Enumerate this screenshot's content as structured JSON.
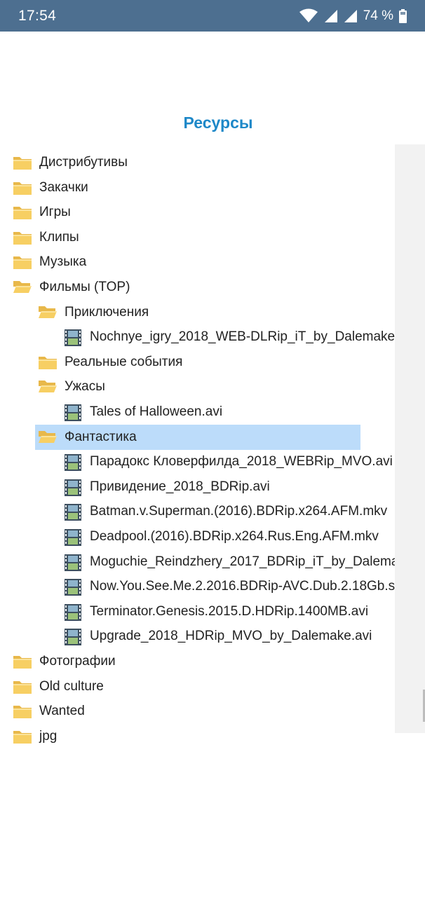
{
  "status_bar": {
    "time": "17:54",
    "battery": "74 %",
    "icons": [
      "wifi-icon",
      "signal-icon",
      "signal-icon",
      "battery-icon"
    ]
  },
  "title": "Ресурсы",
  "tree": [
    {
      "label": "Дистрибутивы",
      "type": "folder",
      "level": 0,
      "open": false
    },
    {
      "label": "Закачки",
      "type": "folder",
      "level": 0,
      "open": false
    },
    {
      "label": "Игры",
      "type": "folder",
      "level": 0,
      "open": false
    },
    {
      "label": "Клипы",
      "type": "folder",
      "level": 0,
      "open": false
    },
    {
      "label": "Музыка",
      "type": "folder",
      "level": 0,
      "open": false
    },
    {
      "label": "Фильмы (TOP)",
      "type": "folder",
      "level": 0,
      "open": true
    },
    {
      "label": "Приключения",
      "type": "folder",
      "level": 1,
      "open": true
    },
    {
      "label": "Nochnye_igry_2018_WEB-DLRip_iT_by_Dalemake.",
      "type": "video",
      "level": 2
    },
    {
      "label": "Реальные события",
      "type": "folder",
      "level": 1,
      "open": false
    },
    {
      "label": "Ужасы",
      "type": "folder",
      "level": 1,
      "open": true
    },
    {
      "label": "Tales of Halloween.avi",
      "type": "video",
      "level": 2
    },
    {
      "label": "Фантастика",
      "type": "folder",
      "level": 1,
      "open": true,
      "selected": true
    },
    {
      "label": "Парадокс Кловерфилда_2018_WEBRip_MVO.avi",
      "type": "video",
      "level": 2
    },
    {
      "label": "Привидение_2018_BDRip.avi",
      "type": "video",
      "level": 2
    },
    {
      "label": "Batman.v.Superman.(2016).BDRip.x264.AFM.mkv",
      "type": "video",
      "level": 2
    },
    {
      "label": "Deadpool.(2016).BDRip.x264.Rus.Eng.AFM.mkv",
      "type": "video",
      "level": 2
    },
    {
      "label": "Moguchie_Reindzhery_2017_BDRip_iT_by_Dalema",
      "type": "video",
      "level": 2
    },
    {
      "label": "Now.You.See.Me.2.2016.BDRip-AVC.Dub.2.18Gb.s",
      "type": "video",
      "level": 2
    },
    {
      "label": "Terminator.Genesis.2015.D.HDRip.1400MB.avi",
      "type": "video",
      "level": 2
    },
    {
      "label": "Upgrade_2018_HDRip_MVO_by_Dalemake.avi",
      "type": "video",
      "level": 2
    },
    {
      "label": "Фотографии",
      "type": "folder",
      "level": 0,
      "open": false
    },
    {
      "label": "Old culture",
      "type": "folder",
      "level": 0,
      "open": false
    },
    {
      "label": "Wanted",
      "type": "folder",
      "level": 0,
      "open": false
    },
    {
      "label": "jpg",
      "type": "folder",
      "level": 0,
      "open": false
    }
  ],
  "colors": {
    "status_bar": "#4d6f90",
    "title": "#1e88c8",
    "selection": "#bcdcfa",
    "folder": "#f5c95a"
  }
}
